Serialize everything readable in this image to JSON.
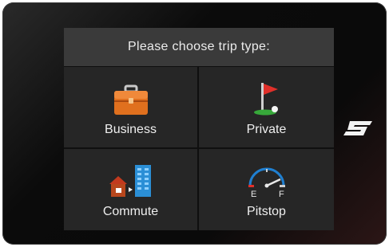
{
  "screen": {
    "title": "Please choose trip type:"
  },
  "options": [
    {
      "label": "Business",
      "icon": "briefcase-icon"
    },
    {
      "label": "Private",
      "icon": "golf-flag-icon"
    },
    {
      "label": "Commute",
      "icon": "home-to-office-icon"
    },
    {
      "label": "Pitstop",
      "icon": "fuel-gauge-icon"
    }
  ],
  "gauge": {
    "empty_label": "E",
    "full_label": "F"
  },
  "colors": {
    "title_bar": "#3a3a3a",
    "cell": "#262626",
    "briefcase": "#e0701e",
    "flag": "#e0302a",
    "building": "#2b8fd6",
    "gauge_arc": "#1f7fd0"
  }
}
